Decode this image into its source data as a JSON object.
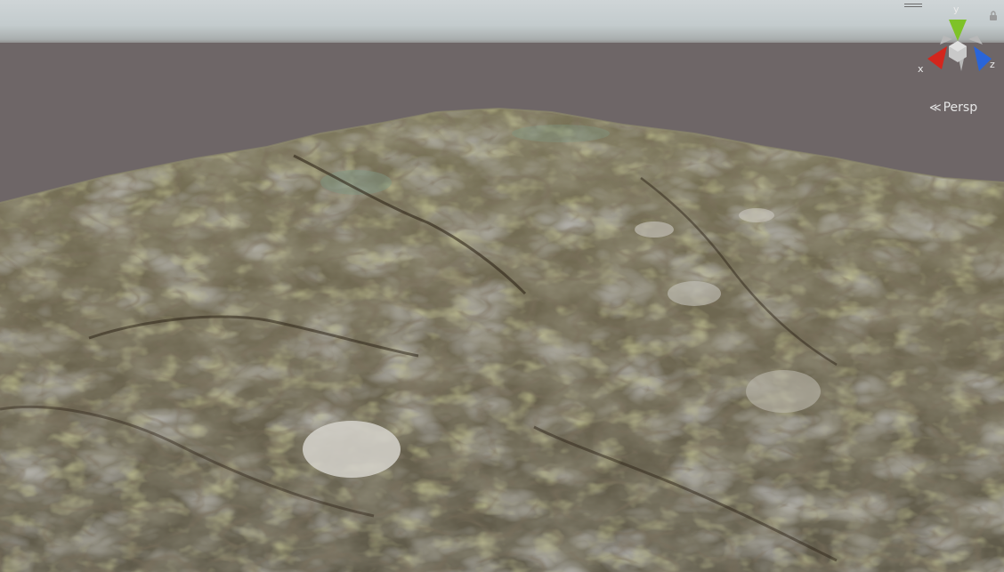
{
  "scene_view": {
    "projection_label": "Persp",
    "gizmo": {
      "x_label": "x",
      "y_label": "y",
      "z_label": "z",
      "colors": {
        "x": "#d3261d",
        "y": "#7ec228",
        "z": "#2a65d8",
        "center": "#c9c9c9"
      }
    },
    "colors": {
      "sky": "#c8cfd1",
      "ground": "#6e6667",
      "terrain_base": "#6d6650",
      "terrain_moss": "#8a8a48",
      "terrain_rock": "#8a8a8c",
      "terrain_crack": "#3a2e20"
    }
  }
}
